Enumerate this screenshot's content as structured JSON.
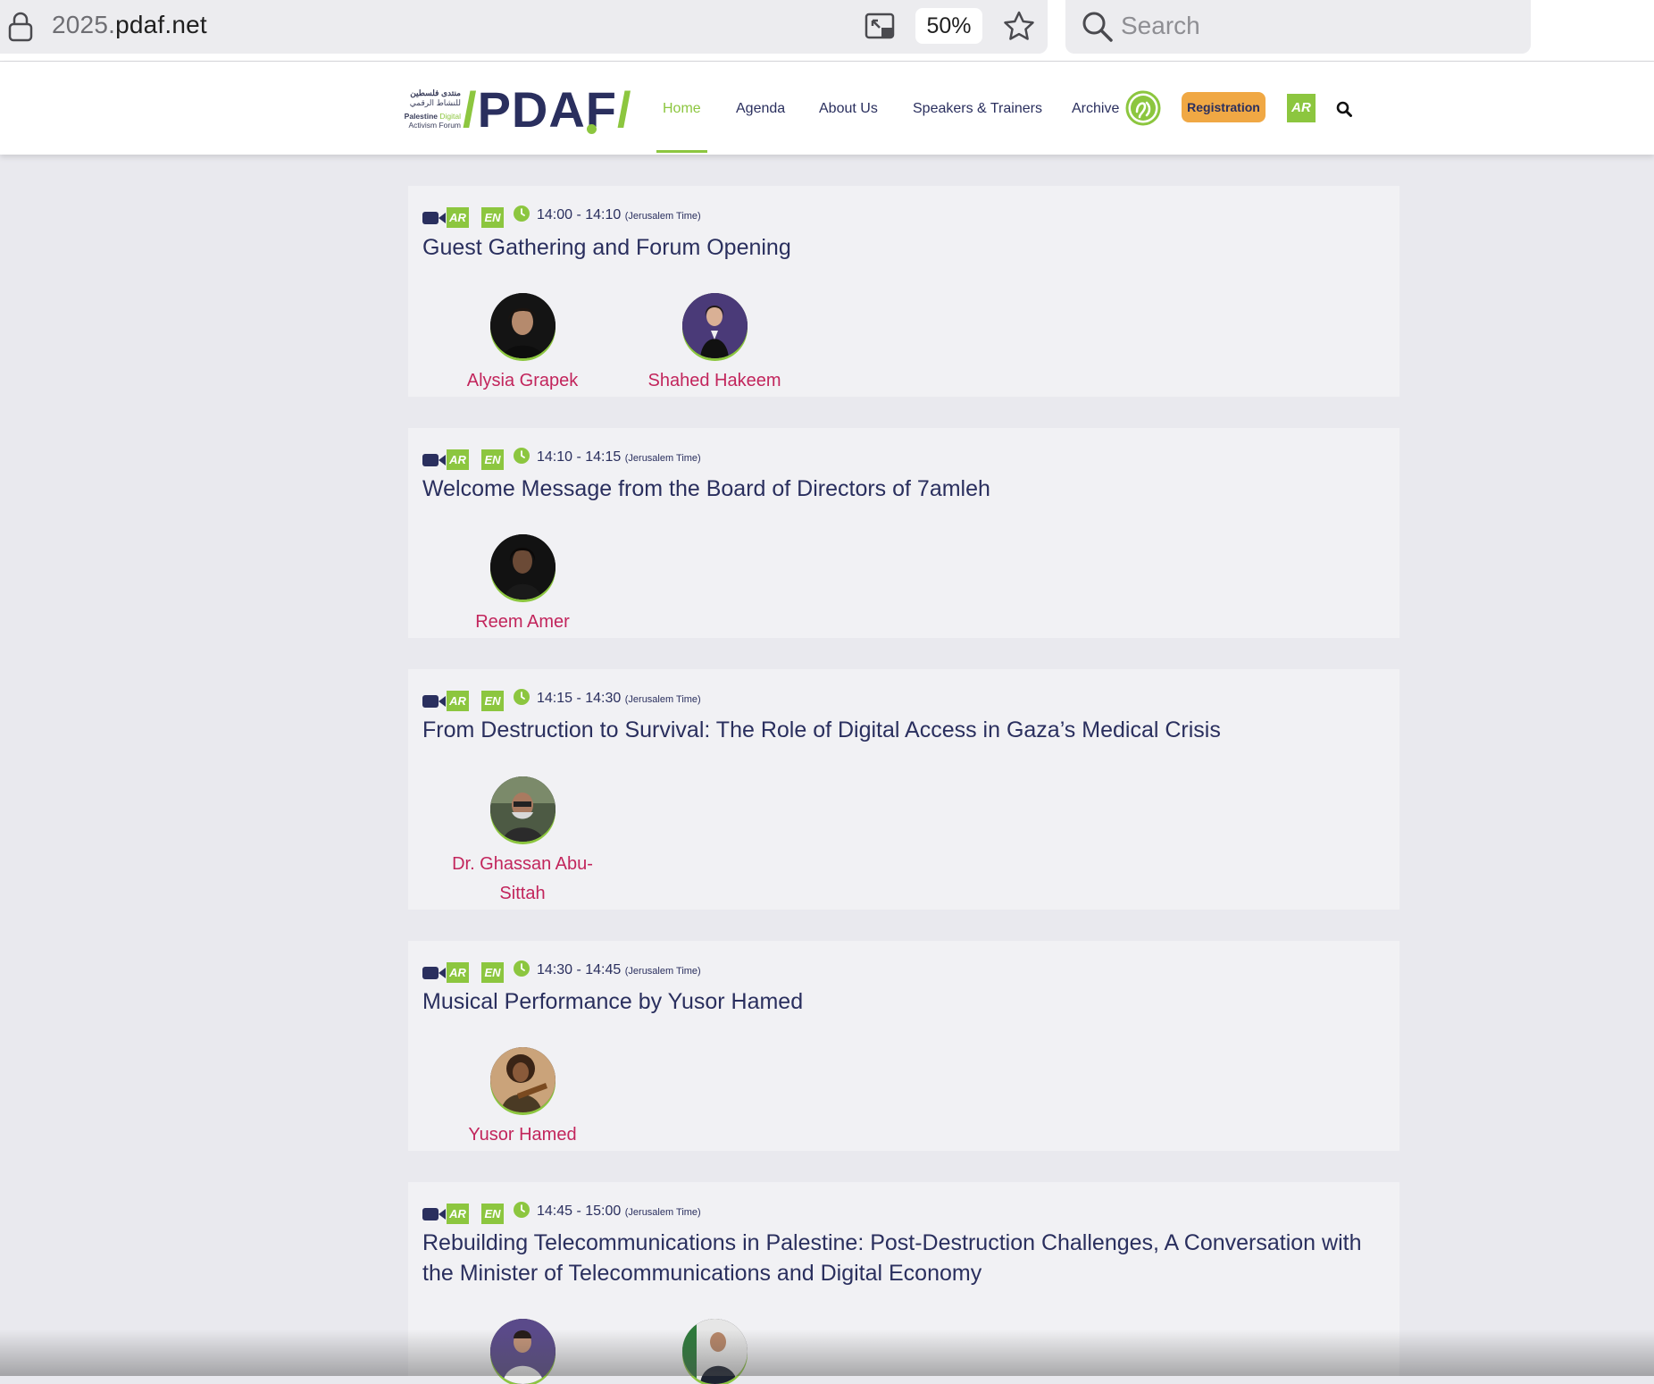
{
  "browser": {
    "url_prefix": "2025.",
    "url_domain": "pdaf.net",
    "zoom": "50%",
    "search_placeholder": "Search"
  },
  "site": {
    "logo": {
      "arabic_line1": "منتدى فلسطين",
      "arabic_line2": "للنشاط الرقمي",
      "english_bold": "Palestine",
      "english_green": "Digital",
      "english_line2": "Activism Forum",
      "mark": "PDAF"
    },
    "nav": [
      "Home",
      "Agenda",
      "About Us",
      "Speakers & Trainers",
      "Archive"
    ],
    "registration_label": "Registration",
    "language_label": "AR",
    "accent_color": "#8cc63f",
    "primary_color": "#2a2f5e",
    "speaker_color": "#c2255c",
    "cta_color": "#f0a844"
  },
  "tags": {
    "ar": "AR",
    "en": "EN",
    "timezone": "(Jerusalem Time)"
  },
  "sessions": [
    {
      "time": "14:00 - 14:10",
      "title": "Guest Gathering and Forum Opening",
      "speakers": [
        {
          "name": "Alysia Grapek",
          "name2": ""
        },
        {
          "name": "Shahed Hakeem",
          "name2": ""
        }
      ]
    },
    {
      "time": "14:10 - 14:15",
      "title": "Welcome Message from the Board of Directors of 7amleh",
      "speakers": [
        {
          "name": "Reem Amer",
          "name2": ""
        }
      ]
    },
    {
      "time": "14:15 - 14:30",
      "title": "From Destruction to Survival: The Role of Digital Access in Gaza’s Medical Crisis",
      "speakers": [
        {
          "name": "Dr. Ghassan Abu-",
          "name2": "Sittah"
        }
      ]
    },
    {
      "time": "14:30 - 14:45",
      "title": "Musical Performance by Yusor Hamed",
      "speakers": [
        {
          "name": "Yusor Hamed",
          "name2": ""
        }
      ]
    },
    {
      "time": "14:45 - 15:00",
      "title": "Rebuilding Telecommunications in Palestine: Post-Destruction Challenges, A Conversation with",
      "title2": "the Minister of Telecommunications and Digital Economy",
      "speakers": [
        {
          "name": "",
          "name2": ""
        },
        {
          "name": "",
          "name2": ""
        }
      ]
    }
  ]
}
